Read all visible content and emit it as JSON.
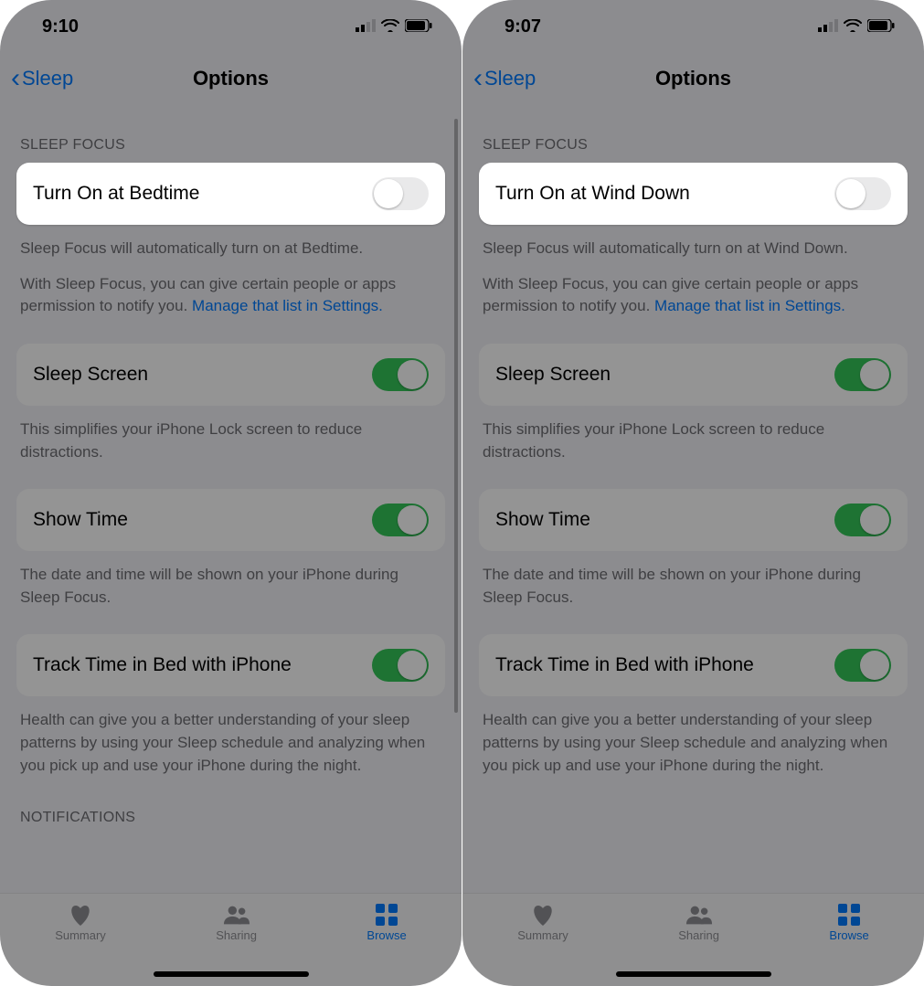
{
  "screens": [
    {
      "status": {
        "time": "9:10"
      },
      "nav": {
        "back": "Sleep",
        "title": "Options"
      },
      "sleep_focus": {
        "header": "SLEEP FOCUS",
        "toggle_label": "Turn On at Bedtime",
        "toggle_on": false,
        "note1": "Sleep Focus will automatically turn on at Bedtime.",
        "note2_prefix": "With Sleep Focus, you can give certain people or apps permission to notify you. ",
        "note2_link": "Manage that list in Settings."
      },
      "rows": [
        {
          "label": "Sleep Screen",
          "on": true,
          "note": "This simplifies your iPhone Lock screen to reduce distractions."
        },
        {
          "label": "Show Time",
          "on": true,
          "note": "The date and time will be shown on your iPhone during Sleep Focus."
        },
        {
          "label": "Track Time in Bed with iPhone",
          "on": true,
          "note": "Health can give you a better understanding of your sleep patterns by using your Sleep schedule and analyzing when you pick up and use your iPhone during the night."
        }
      ],
      "notifications_header": "NOTIFICATIONS",
      "tabs": {
        "summary": "Summary",
        "sharing": "Sharing",
        "browse": "Browse"
      },
      "show_scrollbar": true
    },
    {
      "status": {
        "time": "9:07"
      },
      "nav": {
        "back": "Sleep",
        "title": "Options"
      },
      "sleep_focus": {
        "header": "SLEEP FOCUS",
        "toggle_label": "Turn On at Wind Down",
        "toggle_on": false,
        "note1": "Sleep Focus will automatically turn on at Wind Down.",
        "note2_prefix": "With Sleep Focus, you can give certain people or apps permission to notify you. ",
        "note2_link": "Manage that list in Settings."
      },
      "rows": [
        {
          "label": "Sleep Screen",
          "on": true,
          "note": "This simplifies your iPhone Lock screen to reduce distractions."
        },
        {
          "label": "Show Time",
          "on": true,
          "note": "The date and time will be shown on your iPhone during Sleep Focus."
        },
        {
          "label": "Track Time in Bed with iPhone",
          "on": true,
          "note": "Health can give you a better understanding of your sleep patterns by using your Sleep schedule and analyzing when you pick up and use your iPhone during the night."
        }
      ],
      "notifications_header": "",
      "tabs": {
        "summary": "Summary",
        "sharing": "Sharing",
        "browse": "Browse"
      },
      "show_scrollbar": false
    }
  ]
}
